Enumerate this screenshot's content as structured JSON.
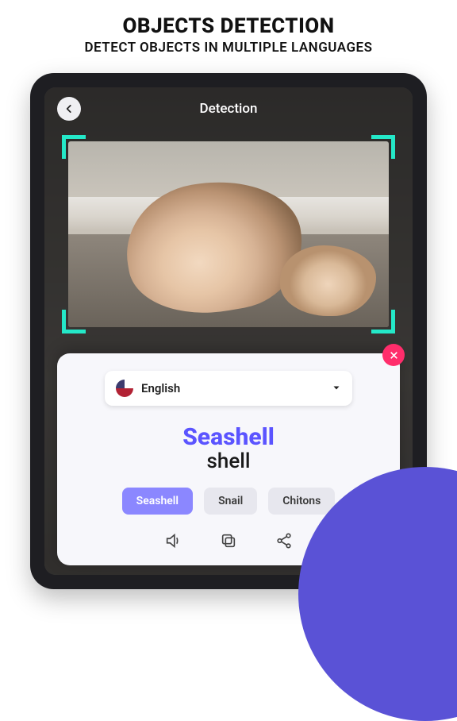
{
  "hero": {
    "title": "OBJECTS DETECTION",
    "subtitle": "DETECT OBJECTS IN MULTIPLE LANGUAGES"
  },
  "topbar": {
    "title": "Detection"
  },
  "language": {
    "label": "English"
  },
  "result": {
    "primary": "Seashell",
    "secondary": "shell"
  },
  "chips": [
    "Seashell",
    "Snail",
    "Chitons"
  ],
  "icons": {
    "back": "chevron-left",
    "close": "x",
    "caret": "caret-down",
    "speaker": "speaker",
    "copy": "copy",
    "share": "share"
  }
}
